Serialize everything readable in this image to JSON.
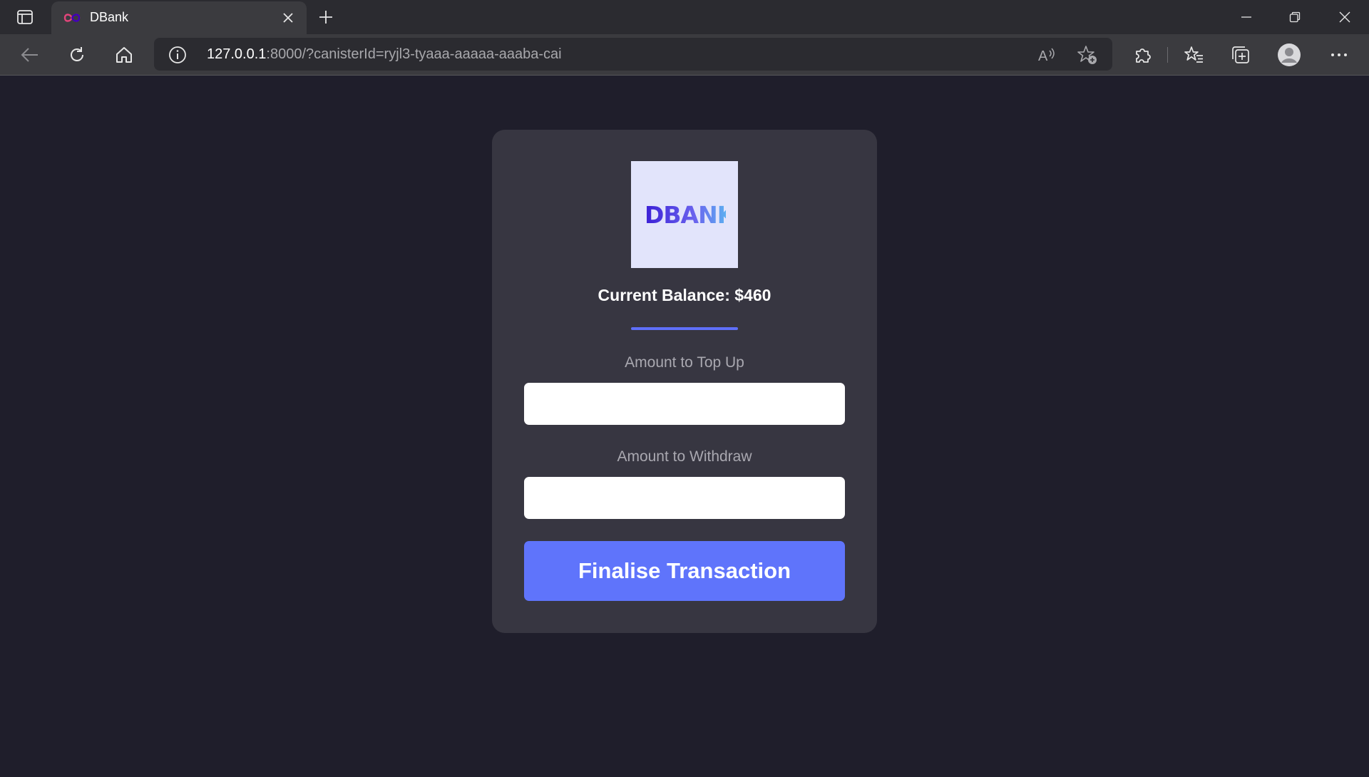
{
  "browser": {
    "tab": {
      "title": "DBank"
    },
    "address": {
      "host": "127.0.0.1",
      "rest": ":8000/?canisterId=ryjl3-tyaaa-aaaaa-aaaba-cai"
    }
  },
  "app": {
    "logo_text": "DBANK",
    "balance_text": "Current Balance: $460",
    "topup_label": "Amount to Top Up",
    "withdraw_label": "Amount to Withdraw",
    "topup_value": "",
    "withdraw_value": "",
    "button_label": "Finalise Transaction"
  },
  "colors": {
    "page_bg": "#1f1e2b",
    "card_bg": "#373641",
    "accent": "#5f74fb",
    "logo_bg": "#e2e4fb"
  }
}
